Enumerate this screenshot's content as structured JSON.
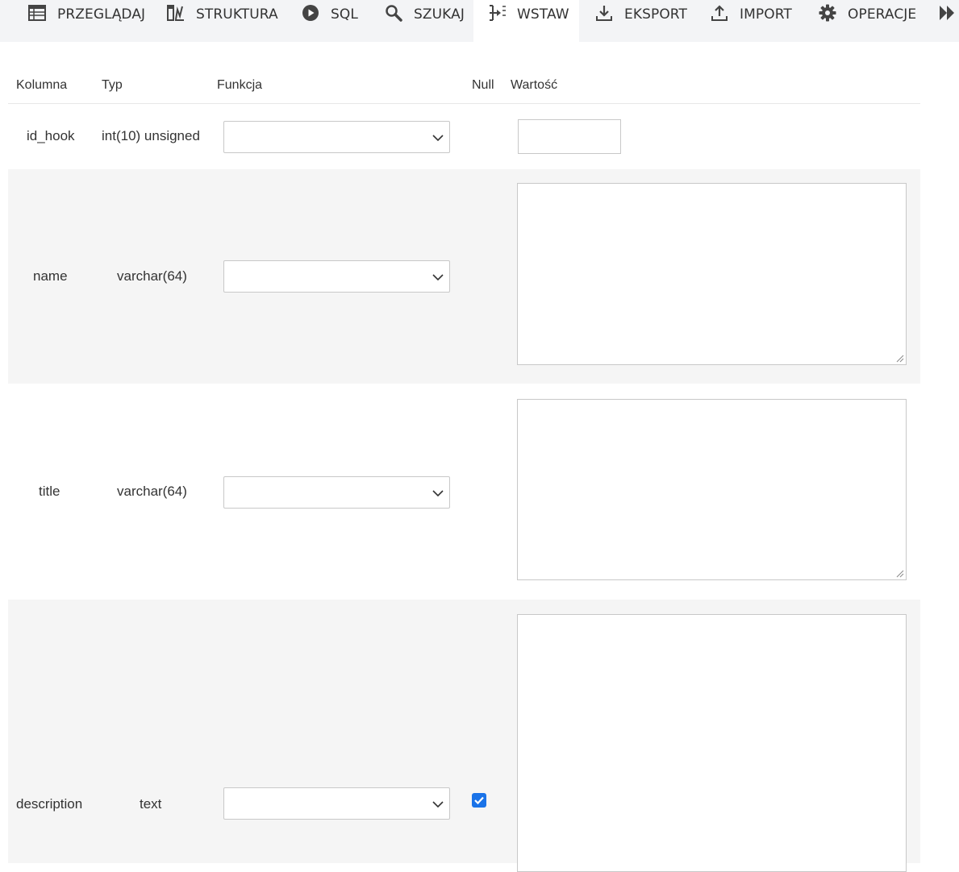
{
  "tabs": [
    {
      "label": "PRZEGLĄDAJ",
      "icon": "table-browse-icon"
    },
    {
      "label": "STRUKTURA",
      "icon": "structure-icon"
    },
    {
      "label": "SQL",
      "icon": "sql-play-icon"
    },
    {
      "label": "SZUKAJ",
      "icon": "search-icon"
    },
    {
      "label": "WSTAW",
      "icon": "insert-icon"
    },
    {
      "label": "EKSPORT",
      "icon": "export-icon"
    },
    {
      "label": "IMPORT",
      "icon": "import-icon"
    },
    {
      "label": "OPERACJE",
      "icon": "gear-icon"
    }
  ],
  "active_tab": "WSTAW",
  "more_icon": "more-tabs-icon",
  "headers": {
    "column": "Kolumna",
    "type": "Typ",
    "function": "Funkcja",
    "null": "Null",
    "value": "Wartość"
  },
  "rows": [
    {
      "column": "id_hook",
      "type": "int(10) unsigned",
      "function": "",
      "null_checked": false,
      "value": ""
    },
    {
      "column": "name",
      "type": "varchar(64)",
      "function": "",
      "null_checked": false,
      "value": ""
    },
    {
      "column": "title",
      "type": "varchar(64)",
      "function": "",
      "null_checked": false,
      "value": ""
    },
    {
      "column": "description",
      "type": "text",
      "function": "",
      "null_checked": true,
      "value": ""
    }
  ],
  "colors": {
    "tabbar_bg": "#f3f4f6",
    "alt_row_bg": "#f5f5f5",
    "checkbox": "#1a73e8"
  }
}
